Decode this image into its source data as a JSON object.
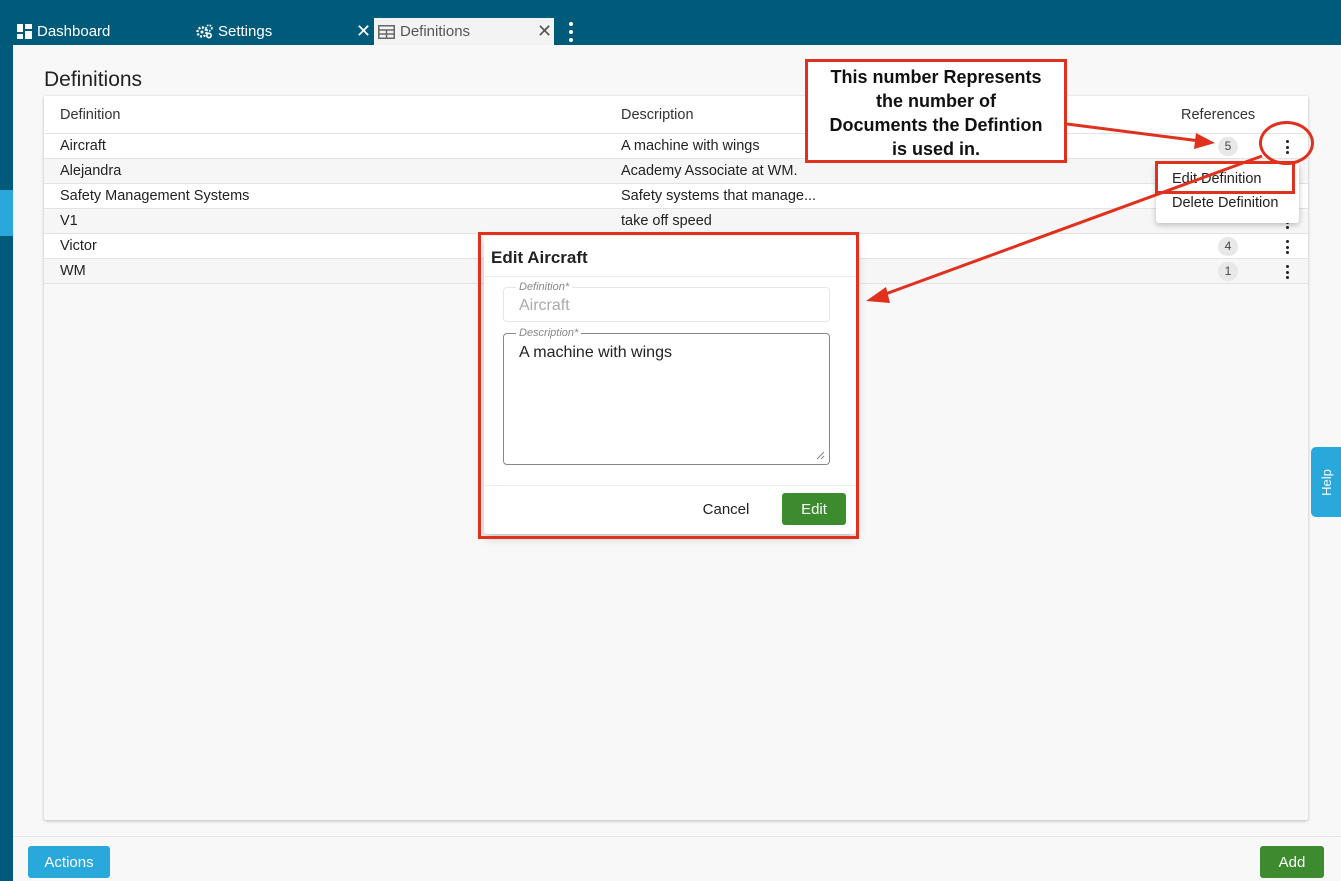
{
  "tabs": [
    {
      "label": "Dashboard",
      "icon": "dashboard-icon"
    },
    {
      "label": "Settings",
      "icon": "gears-icon"
    },
    {
      "label": "Definitions",
      "icon": "table-icon",
      "active": true
    }
  ],
  "page": {
    "title": "Definitions"
  },
  "table": {
    "headers": {
      "definition": "Definition",
      "description": "Description",
      "references": "References"
    },
    "rows": [
      {
        "definition": "Aircraft",
        "description": "A machine with wings",
        "references": "5"
      },
      {
        "definition": "Alejandra",
        "description": "Academy Associate at WM.",
        "references": ""
      },
      {
        "definition": "Safety Management Systems",
        "description": "Safety systems that manage...",
        "references": ""
      },
      {
        "definition": "V1",
        "description": "take off speed",
        "references": ""
      },
      {
        "definition": "Victor",
        "description": "",
        "references": "4"
      },
      {
        "definition": "WM",
        "description": "",
        "references": "1"
      }
    ]
  },
  "row_menu": {
    "edit": "Edit Definition",
    "delete": "Delete Definition"
  },
  "modal": {
    "title": "Edit Aircraft",
    "definition_label": "Definition*",
    "definition_value": "Aircraft",
    "description_label": "Description*",
    "description_value": "A machine with wings",
    "cancel": "Cancel",
    "edit": "Edit"
  },
  "annotation": {
    "line1": "This number Represents",
    "line2": "the number of",
    "line3": "Documents the Defintion",
    "line4": "is used in."
  },
  "footer": {
    "actions": "Actions",
    "add": "Add"
  },
  "help": "Help",
  "colors": {
    "header": "#005a7a",
    "accent": "#29a8dc",
    "primary": "#3d8b2f",
    "annotation": "#e0301e"
  }
}
